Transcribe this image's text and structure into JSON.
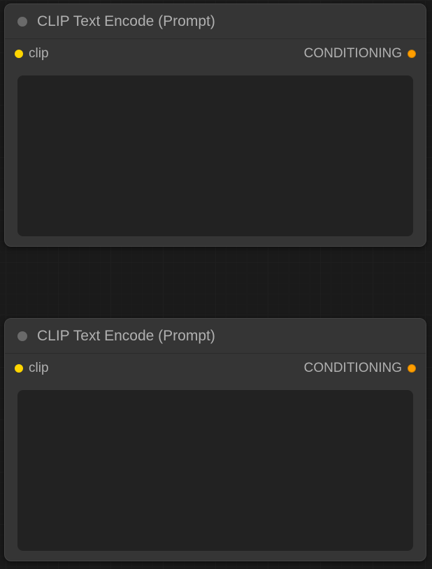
{
  "nodes": [
    {
      "title": "CLIP Text Encode (Prompt)",
      "input_label": "clip",
      "output_label": "CONDITIONING",
      "text_value": ""
    },
    {
      "title": "CLIP Text Encode (Prompt)",
      "input_label": "clip",
      "output_label": "CONDITIONING",
      "text_value": ""
    }
  ]
}
